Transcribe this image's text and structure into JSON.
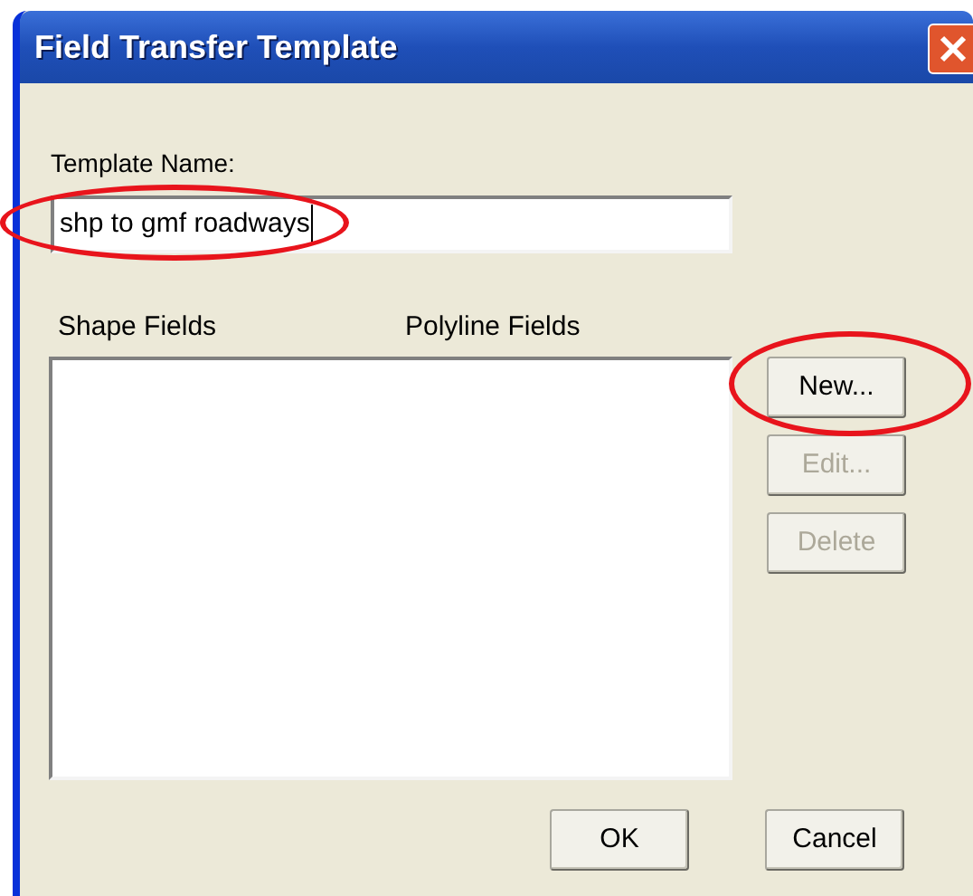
{
  "window": {
    "title": "Field Transfer Template"
  },
  "template_name": {
    "label": "Template Name:",
    "value": "shp to gmf roadways",
    "annotated": true
  },
  "columns": [
    "Shape Fields",
    "Polyline Fields"
  ],
  "side_buttons": [
    {
      "label": "New...",
      "disabled": false,
      "annotated": true
    },
    {
      "label": "Edit...",
      "disabled": true,
      "annotated": false
    },
    {
      "label": "Delete",
      "disabled": true,
      "annotated": false
    }
  ],
  "buttons": [
    {
      "label": "OK"
    },
    {
      "label": "Cancel"
    }
  ]
}
